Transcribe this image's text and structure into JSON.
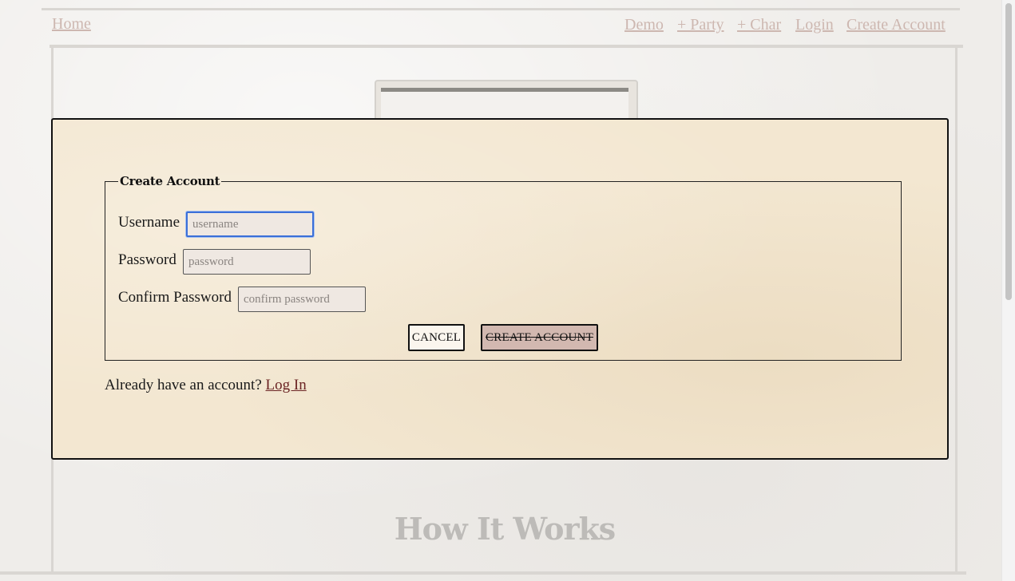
{
  "nav": {
    "home": "Home",
    "demo": "Demo",
    "party": "+ Party",
    "char": "+ Char",
    "login": "Login",
    "create_account": "Create Account"
  },
  "form": {
    "legend": "Create Account",
    "username_label": "Username",
    "username_placeholder": "username",
    "password_label": "Password",
    "password_placeholder": "password",
    "confirm_label": "Confirm Password",
    "confirm_placeholder": "confirm password",
    "cancel_label": "CANCEL",
    "create_label": "CREATE ACCOUNT"
  },
  "footer_prompt": {
    "text": "Already have an account?",
    "link": "Log In"
  },
  "section": {
    "title": "How It Works"
  },
  "colors": {
    "modal_bg": "#f3e7d1",
    "create_button_bg": "#d2b8b0",
    "focus_ring": "#3b6fd8",
    "link": "#6b2424",
    "nav_link": "#cdb7b0"
  }
}
